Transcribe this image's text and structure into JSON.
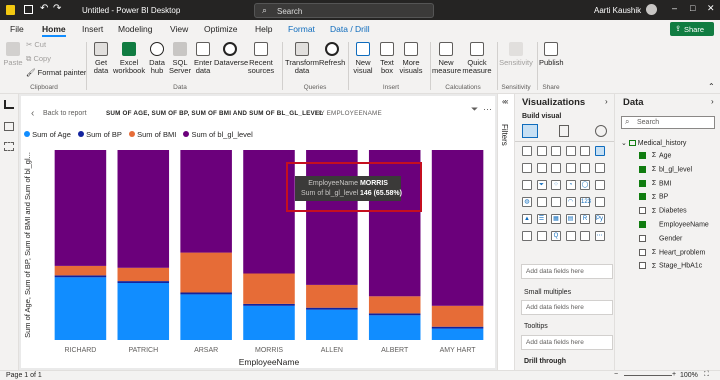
{
  "titlebar": {
    "title": "Untitled - Power BI Desktop",
    "search": "Search",
    "user": "Aarti Kaushik"
  },
  "menu": [
    "File",
    "Home",
    "Insert",
    "Modeling",
    "View",
    "Optimize",
    "Help",
    "Format",
    "Data / Drill"
  ],
  "share": "Share",
  "ribbon": {
    "clipboard": {
      "paste": "Paste",
      "cut": "Cut",
      "copy": "Copy",
      "format_painter": "Format painter",
      "label": "Clipboard"
    },
    "data": {
      "items": [
        "Get data",
        "Excel workbook",
        "Data hub",
        "SQL Server",
        "Enter data",
        "Dataverse",
        "Recent sources"
      ],
      "label": "Data"
    },
    "queries": {
      "items": [
        "Transform data",
        "Refresh"
      ],
      "label": "Queries"
    },
    "insert": {
      "items": [
        "New visual",
        "Text box",
        "More visuals"
      ],
      "label": "Insert"
    },
    "calculations": {
      "items": [
        "New measure",
        "Quick measure"
      ],
      "label": "Calculations"
    },
    "sensitivity": {
      "item": "Sensitivity",
      "label": "Sensitivity"
    },
    "share": {
      "item": "Publish",
      "label": "Share"
    }
  },
  "report": {
    "back": "Back to report",
    "header": "SUM OF AGE, SUM OF BP, SUM OF BMI AND SUM OF BL_GL_LEVEL",
    "by": "BY EMPLOYEENAME"
  },
  "chart_data": {
    "type": "bar",
    "stacked": "100%",
    "xlabel": "EmployeeName",
    "ylabel": "Sum of Age, Sum of BP, Sum of BMI and Sum of bl_gl...",
    "ylim": [
      0,
      100
    ],
    "yticks": [],
    "legend_position": "top-left",
    "categories": [
      "RICHARD",
      "PATRICH",
      "ARSAR",
      "MORRIS",
      "ALLEN",
      "ALBERT",
      "AMY HART"
    ],
    "series": [
      {
        "name": "Sum of Age",
        "color": "#118dff",
        "values": [
          33,
          30,
          24,
          18,
          16,
          13,
          6
        ]
      },
      {
        "name": "Sum of BP",
        "color": "#12239e",
        "values": [
          1,
          1,
          1,
          1,
          1,
          1,
          1
        ]
      },
      {
        "name": "Sum of BMI",
        "color": "#e66c37",
        "values": [
          5,
          7,
          21,
          16,
          12,
          9,
          11
        ]
      },
      {
        "name": "Sum of bl_gl_level",
        "color": "#6b007b",
        "values": [
          61,
          62,
          54,
          65,
          71,
          77,
          82
        ]
      }
    ]
  },
  "tooltip": {
    "k1": "EmployeeName",
    "v1": "MORRIS",
    "k2": "Sum of bl_gl_level",
    "v2": "146 (65.58%)"
  },
  "filters": "Filters",
  "viz": {
    "title": "Visualizations",
    "build": "Build visual",
    "add1": "Add data fields here",
    "small_multiples": "Small multiples",
    "add2": "Add data fields here",
    "tooltips": "Tooltips",
    "add3": "Add data fields here",
    "drill": "Drill through"
  },
  "data_pane": {
    "title": "Data",
    "search": "Search",
    "table": "Medical_history",
    "fields": [
      {
        "name": "Age",
        "checked": true,
        "sigma": true
      },
      {
        "name": "bl_gl_level",
        "checked": true,
        "sigma": true
      },
      {
        "name": "BMI",
        "checked": true,
        "sigma": true
      },
      {
        "name": "BP",
        "checked": true,
        "sigma": true
      },
      {
        "name": "Diabetes",
        "checked": false,
        "sigma": true
      },
      {
        "name": "EmployeeName",
        "checked": true,
        "sigma": false
      },
      {
        "name": "Gender",
        "checked": false,
        "sigma": false
      },
      {
        "name": "Heart_problem",
        "checked": false,
        "sigma": true
      },
      {
        "name": "Stage_HbA1c",
        "checked": false,
        "sigma": true
      }
    ]
  },
  "status": {
    "page": "Page 1 of 1",
    "zoom": "100%"
  }
}
